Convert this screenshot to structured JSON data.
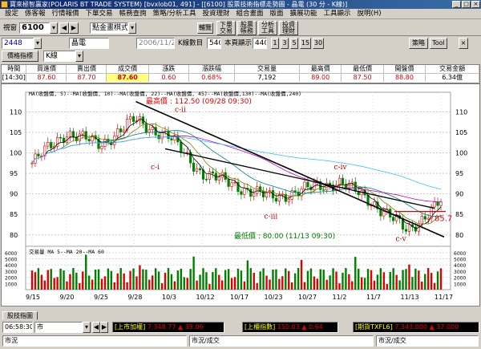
{
  "window": {
    "title": "寶來極智贏家(POLARIS BT TRADE SYSTEM) [bvxlob01, 491] - [[6100] 股票技術指標走勢圖 - 晶電 (30 分 - K線)]",
    "btn_min": "_",
    "btn_max": "□",
    "btn_close": "×"
  },
  "menu": [
    "設定",
    "係客報",
    "行情報價",
    "下單交易",
    "帳務查詢",
    "策略/分析工具",
    "投資理財",
    "組合畫面",
    "版面",
    "擴展功能",
    "工具顯示",
    "說明(H)"
  ],
  "toolbar": {
    "screen_label": "視窗",
    "screen_code": "6100",
    "mode_value": "點金畫棋式",
    "date_value": "2006/11/22",
    "kcount_label": "K線數目",
    "kcount_value": "540",
    "display_label": "本頁顯示",
    "display_value": "440",
    "help_btn": "輔覽",
    "buttons": [
      "下單\n交易",
      "股票\n帳務",
      "分析\n工具",
      "投資\n理財"
    ]
  },
  "toolbar2": {
    "stock_code": "2448",
    "stock_name": "晶電",
    "intervals": [
      "1",
      "3",
      "5",
      "15",
      "30"
    ],
    "strategy_btn": "策略",
    "tool_btn": "Tool"
  },
  "toolbar3": {
    "indicator_btn": "價格指標",
    "kline_value": "K線"
  },
  "quote": {
    "headers": [
      "時間",
      "買進價",
      "賣出價",
      "成交價",
      "漲跌",
      "漲跌幅",
      "交易量",
      "最高價",
      "最低價",
      "開盤價",
      "交易金額"
    ],
    "values": [
      "[14:30]",
      "87.60",
      "87.70",
      "87.60",
      "0.60",
      "0.68%",
      "7,192",
      "89.00",
      "87.50",
      "88.80",
      "6.34億"
    ]
  },
  "chart": {
    "ma_legend": "MA(收盤價,  5)--MA(收盤價, 10)--MA(收盤價, 22)--MA(收盤價, 45)--MA(收盤價,130)--MA(收盤價,240)",
    "high_label": "最高價 : 112.50 (09/28 09:30)",
    "low_label": "最低價 : 80.00 (11/13 09:30)",
    "last_price_label": "85.7",
    "wave_labels": [
      "c-i",
      "c-ii",
      "c-iii",
      "c-iv",
      "c-v"
    ],
    "vol_legend": "交易量 MA   5--MA 20--MA 60",
    "price_ticks": [
      "110",
      "105",
      "100",
      "95",
      "90",
      "85",
      "80"
    ],
    "vol_ticks": [
      "6000",
      "5000",
      "4000",
      "3000",
      "2000",
      "1000"
    ],
    "dates": [
      "9/15",
      "9/20",
      "9/25",
      "9/28",
      "10/3",
      "10/12",
      "10/17",
      "10/23",
      "10/27",
      "11/2",
      "11/7",
      "11/13",
      "11/17"
    ]
  },
  "chart_data": {
    "type": "candlestick",
    "ylim": [
      78,
      114
    ],
    "vol_ylim": [
      0,
      6500
    ],
    "x": [
      "9/15",
      "9/20",
      "9/25",
      "9/28",
      "10/3",
      "10/12",
      "10/17",
      "10/23",
      "10/27",
      "11/2",
      "11/7",
      "11/13",
      "11/17"
    ],
    "close": [
      97.5,
      105,
      102,
      108,
      104,
      95,
      92,
      89,
      91,
      93,
      88,
      81,
      88
    ],
    "annotations": [
      {
        "label": "c-i",
        "x": "10/3",
        "y": 99
      },
      {
        "label": "c-ii",
        "x": "10/3",
        "y": 110
      },
      {
        "label": "c-iii",
        "x": "10/23",
        "y": 86
      },
      {
        "label": "c-iv",
        "x": "11/2",
        "y": 95
      },
      {
        "label": "c-v",
        "x": "11/13",
        "y": 79
      }
    ],
    "high": 112.5,
    "low": 80.0,
    "last": 85.7
  },
  "tabs": {
    "tab1": "股技指圖"
  },
  "status": {
    "time": "06:58:30",
    "market": "市",
    "tse_label": "[上市加權]",
    "tse_value": "7,348.77",
    "tse_change": "▲ 39.06",
    "otc_label": "[上櫃指數]",
    "otc_value": "150.03",
    "otc_change": "▲ 0.64",
    "fut_label": "[期貨TXFL6]",
    "fut_value": "7,343.000",
    "fut_change": "▲ 37.000",
    "row2_a": "市況",
    "row2_b": "市況/成交",
    "row2_c": "市況/成交"
  },
  "colors": {
    "up": "#e00000",
    "down": "#008000",
    "trend": "#000000",
    "ma_blue": "#40c0ff",
    "ma_magenta": "#c000c0"
  }
}
